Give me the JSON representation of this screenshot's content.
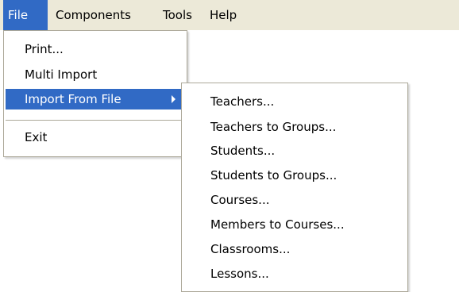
{
  "menubar": {
    "items": [
      {
        "label": "File"
      },
      {
        "label": "Components"
      },
      {
        "label": "Tools"
      },
      {
        "label": "Help"
      }
    ]
  },
  "file_menu": {
    "items": [
      {
        "label": "Print..."
      },
      {
        "label": "Multi Import"
      },
      {
        "label": "Import From File"
      },
      {
        "label": "Exit"
      }
    ]
  },
  "import_submenu": {
    "items": [
      {
        "label": "Teachers..."
      },
      {
        "label": "Teachers to Groups..."
      },
      {
        "label": "Students..."
      },
      {
        "label": "Students to Groups..."
      },
      {
        "label": "Courses..."
      },
      {
        "label": "Members to Courses..."
      },
      {
        "label": "Classrooms..."
      },
      {
        "label": "Lessons..."
      }
    ]
  },
  "colors": {
    "menubar_bg": "#ece9d8",
    "highlight": "#316ac5",
    "border": "#aca899"
  }
}
